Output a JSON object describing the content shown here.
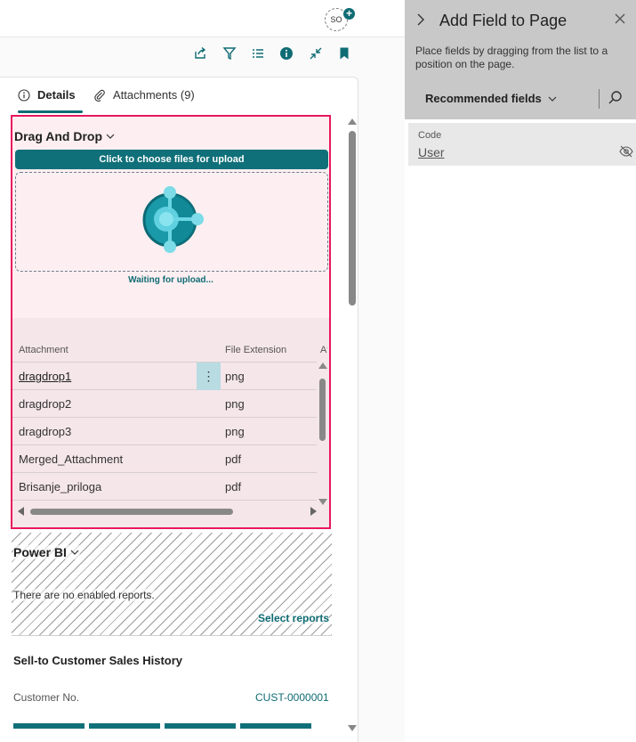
{
  "topbar": {
    "avatar_initials": "SO",
    "avatar_badge": "+"
  },
  "toolbar": {
    "icons": [
      "share-icon",
      "filter-icon",
      "list-icon",
      "info-icon",
      "collapse-icon",
      "bookmark-icon"
    ]
  },
  "factbox": {
    "tabs": [
      {
        "label": "Details",
        "icon": "info-icon",
        "active": true
      },
      {
        "label": "Attachments (9)",
        "icon": "paperclip-icon",
        "active": false
      }
    ]
  },
  "drag_drop": {
    "title": "Drag And Drop",
    "upload_button": "Click to choose files for upload",
    "status": "Waiting for upload...",
    "columns": [
      "Attachment",
      "File Extension",
      "At"
    ],
    "rows": [
      {
        "name": "dragdrop1",
        "ext": "png"
      },
      {
        "name": "dragdrop2",
        "ext": "png"
      },
      {
        "name": "dragdrop3",
        "ext": "png"
      },
      {
        "name": "Merged_Attachment",
        "ext": "pdf"
      },
      {
        "name": "Brisanje_priloga",
        "ext": "pdf"
      }
    ],
    "row_menu": "⋮"
  },
  "power_bi": {
    "title": "Power BI",
    "empty_text": "There are no enabled reports.",
    "select_link": "Select reports"
  },
  "sales_history": {
    "title": "Sell-to Customer Sales History",
    "customer_label": "Customer No.",
    "customer_value": "CUST-0000001"
  },
  "add_field_panel": {
    "title": "Add Field to Page",
    "description": "Place fields by dragging from the list to a position on the page.",
    "dropdown_label": "Recommended fields",
    "field": {
      "label": "Code",
      "value": "User"
    }
  },
  "colors": {
    "accent": "#0f6c74",
    "highlight_border": "#e8175d",
    "panel_bg": "#fdeff1"
  }
}
